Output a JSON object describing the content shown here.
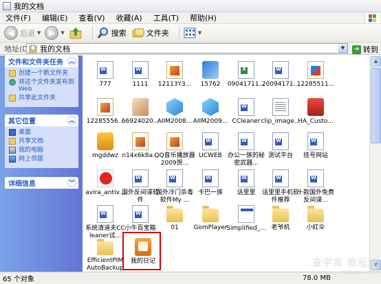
{
  "window": {
    "title": "我的文档"
  },
  "menu": [
    "文件(F)",
    "编辑(E)",
    "查看(V)",
    "收藏(A)",
    "工具(T)",
    "帮助(H)"
  ],
  "toolbar": {
    "back": "后退",
    "search": "搜索",
    "folders": "文件夹"
  },
  "address": {
    "label": "地址(D)",
    "value": "我的文档",
    "go": "转到"
  },
  "tasks": [
    {
      "title": "文件和文件夹任务",
      "items": [
        {
          "label": "创建一个新文件夹",
          "icon": "new-folder-icon"
        },
        {
          "label": "将这个文件夹发布到 Web",
          "icon": "web-publish-icon"
        },
        {
          "label": "共享此文件夹",
          "icon": "share-icon"
        }
      ]
    },
    {
      "title": "其它位置",
      "items": [
        {
          "label": "桌面",
          "icon": "desktop-icon"
        },
        {
          "label": "共享文档",
          "icon": "shared-docs-icon"
        },
        {
          "label": "我的电脑",
          "icon": "my-computer-icon"
        },
        {
          "label": "网上邻居",
          "icon": "network-icon"
        }
      ]
    },
    {
      "title": "详细信息",
      "items": []
    }
  ],
  "files": [
    {
      "name": "777",
      "icon": "word-doc-icon"
    },
    {
      "name": "1111",
      "icon": "word-doc-icon"
    },
    {
      "name": "12113Y3...",
      "icon": "image-icon"
    },
    {
      "name": "15762",
      "icon": "shortcut-icon"
    },
    {
      "name": "09041711...",
      "icon": "excel-icon"
    },
    {
      "name": "20094171...",
      "icon": "word-doc-icon"
    },
    {
      "name": "12285511...",
      "icon": "picture-icon"
    },
    {
      "name": "12285556...",
      "icon": "image-icon"
    },
    {
      "name": "66924020...",
      "icon": "hammer-icon"
    },
    {
      "name": "AIIM2008...",
      "icon": "package-icon"
    },
    {
      "name": "AIIM2009...",
      "icon": "package-icon"
    },
    {
      "name": "CCleaner",
      "icon": "word-doc-icon"
    },
    {
      "name": "clip_image...",
      "icon": "text-file-icon"
    },
    {
      "name": "HA_Custo...",
      "icon": "red-app-icon"
    },
    {
      "name": "mgddwz",
      "icon": "monkey-icon"
    },
    {
      "name": "n14x6k8a...",
      "icon": "image-icon"
    },
    {
      "name": "QQ音乐播放器2009贺...",
      "icon": "image-icon"
    },
    {
      "name": "UCWEB",
      "icon": "word-doc-icon"
    },
    {
      "name": "办公一族的秘密武器...",
      "icon": "word-doc-icon"
    },
    {
      "name": "测试平台",
      "icon": "word-doc-icon"
    },
    {
      "name": "挂号网站",
      "icon": "word-doc-icon"
    },
    {
      "name": "avira_antiv...",
      "icon": "avira-icon"
    },
    {
      "name": "国外反间谍软件",
      "icon": "word-doc-icon"
    },
    {
      "name": "国外冷门杀毒软件My ...",
      "icon": "word-doc-icon"
    },
    {
      "name": "卡巴一族",
      "icon": "word-doc-icon"
    },
    {
      "name": "话里里",
      "icon": "word-doc-icon"
    },
    {
      "name": "话里里手机软件推荐",
      "icon": "word-doc-icon"
    },
    {
      "name": "十款国外免费反间谍...",
      "icon": "word-doc-icon"
    },
    {
      "name": "系统清道夫CCleaner试...",
      "icon": "word-doc-icon"
    },
    {
      "name": "小牛百宝箱",
      "icon": "word-doc-icon"
    },
    {
      "name": "01",
      "icon": "folder-icon"
    },
    {
      "name": "GomPlayer",
      "icon": "folder-icon"
    },
    {
      "name": "Simplified_...",
      "icon": "pka-file-icon"
    },
    {
      "name": "老爷机",
      "icon": "folder-icon"
    },
    {
      "name": "小红伞",
      "icon": "folder-icon"
    },
    {
      "name": "EfficientPIM AutoBackup",
      "icon": "folder-icon"
    },
    {
      "name": "我的日记",
      "icon": "notebook-icon"
    }
  ],
  "status": {
    "count": "65 个对象",
    "size": "78.0 MB"
  },
  "watermark": {
    "line1": "查字典 教程网",
    "line2": "jiaocheng.chazidian.com"
  }
}
